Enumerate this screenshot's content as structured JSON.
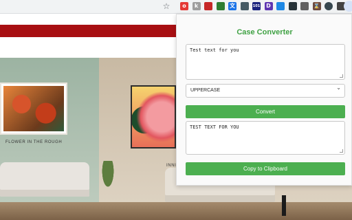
{
  "browser": {
    "bookmark_icon": "star-icon",
    "extensions": [
      {
        "name": "opera-ext-icon",
        "glyph": "o",
        "color": "#e53935"
      },
      {
        "name": "k-ext-icon",
        "glyph": "k",
        "color": "#9e9e9e"
      },
      {
        "name": "shield-ext-icon",
        "glyph": "",
        "color": "#c62828"
      },
      {
        "name": "refresh-ext-icon",
        "glyph": "",
        "color": "#2e7d32"
      },
      {
        "name": "translate-ext-icon",
        "glyph": "文",
        "color": "#1a73e8"
      },
      {
        "name": "checklist-ext-icon",
        "glyph": "",
        "color": "#455a64"
      },
      {
        "name": "numbers-ext-icon",
        "glyph": "101",
        "color": "#1a237e"
      },
      {
        "name": "d-ext-icon",
        "glyph": "D",
        "color": "#5e35b1"
      },
      {
        "name": "bookmark-ext-icon",
        "glyph": "",
        "color": "#1e88e5"
      },
      {
        "name": "terminal-ext-icon",
        "glyph": "",
        "color": "#263238"
      },
      {
        "name": "document-ext-icon",
        "glyph": "",
        "color": "#616161"
      },
      {
        "name": "hourglass-ext-icon",
        "glyph": "⌛",
        "color": "#6d4c41"
      },
      {
        "name": "globe-ext-icon",
        "glyph": "",
        "color": "#37474f"
      },
      {
        "name": "magnifier-ext-icon",
        "glyph": "",
        "color": "#424242"
      }
    ]
  },
  "background": {
    "captions": {
      "left": "FLOWER IN THE ROUGH",
      "right": "INNI"
    }
  },
  "popup": {
    "title": "Case Converter",
    "input_text": "Test text for you",
    "mode_selected": "UPPERCASE",
    "convert_label": "Convert",
    "output_text": "TEST TEXT FOR YOU",
    "copy_label": "Copy to Clipboard",
    "accent_color": "#4caf50",
    "title_color": "#3fa143"
  }
}
